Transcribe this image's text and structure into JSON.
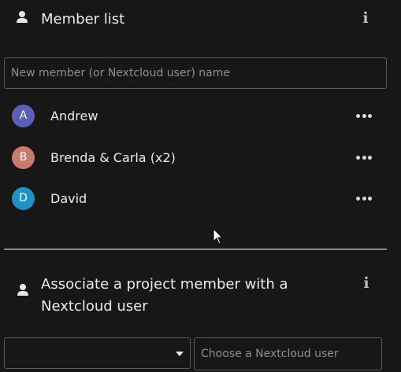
{
  "member_list": {
    "title": "Member list",
    "new_member_placeholder": "New member (or Nextcloud user) name",
    "members": [
      {
        "initial": "A",
        "name": "Andrew",
        "color": "#5b5fb8"
      },
      {
        "initial": "B",
        "name": "Brenda & Carla (x2)",
        "color": "#c97b70"
      },
      {
        "initial": "D",
        "name": "David",
        "color": "#1e92c2"
      }
    ]
  },
  "associate": {
    "title": "Associate a project member with a Nextcloud user",
    "select_value": "",
    "user_placeholder": "Choose a Nextcloud user"
  },
  "icons": {
    "section": "person-icon",
    "info": "info-icon",
    "more": "more-dots-icon",
    "dropdown": "caret-down-icon"
  },
  "colors": {
    "background": "#171717",
    "border": "#5a5a5a",
    "text": "#ebebeb"
  }
}
